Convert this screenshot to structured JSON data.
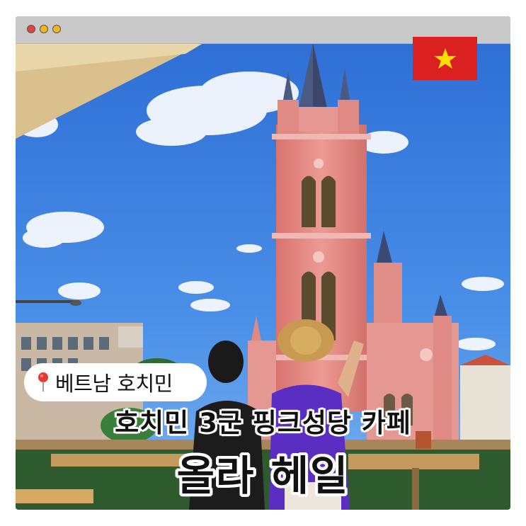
{
  "window": {
    "controls": [
      "close",
      "minimize",
      "maximize"
    ]
  },
  "photo": {
    "subject": "pink church with people on a cafe terrace",
    "colors": {
      "sky": "#3f82e0",
      "church": "#e58a86",
      "flag_red": "#da2020",
      "flag_star": "#ffde00"
    }
  },
  "flag": {
    "icon": "vietnam-flag-icon"
  },
  "location": {
    "icon": "map-pin-icon",
    "label": "베트남 호치민"
  },
  "headline": {
    "subtitle": "호치민 3군 핑크성당 카페",
    "title": "올라 헤일"
  }
}
